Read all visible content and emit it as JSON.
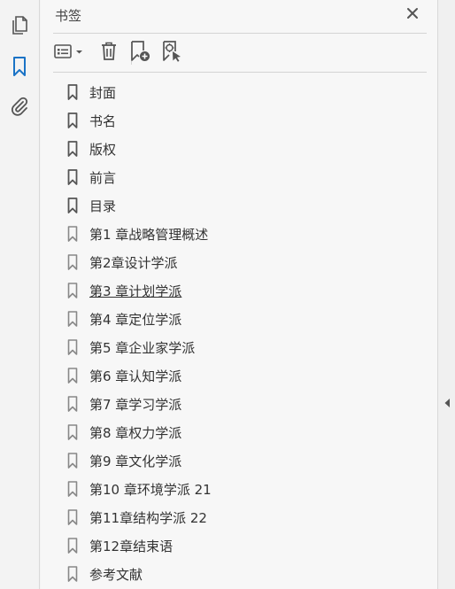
{
  "panel": {
    "title": "书签"
  },
  "icons": {
    "rail": [
      "pages-icon",
      "bookmark-icon",
      "attachment-icon"
    ],
    "toolbar": [
      "options-menu-icon",
      "delete-icon",
      "new-bookmark-icon",
      "new-bookmark-from-structure-icon"
    ],
    "close": "close-icon",
    "collapse": "collapse-arrow-icon"
  },
  "colors": {
    "accent": "#1a73c6",
    "icon": "#555555",
    "text": "#333333"
  },
  "bookmarks": [
    {
      "label": "封面"
    },
    {
      "label": "书名"
    },
    {
      "label": "版权"
    },
    {
      "label": "前言"
    },
    {
      "label": "目录"
    },
    {
      "label": "第1 章战略管理概述"
    },
    {
      "label": "第2章设计学派"
    },
    {
      "label": "第3 章计划学派"
    },
    {
      "label": "第4 章定位学派"
    },
    {
      "label": "第5 章企业家学派"
    },
    {
      "label": "第6 章认知学派"
    },
    {
      "label": "第7 章学习学派"
    },
    {
      "label": "第8 章权力学派"
    },
    {
      "label": "第9 章文化学派"
    },
    {
      "label": "第10 章环境学派  21"
    },
    {
      "label": "第11章结构学派 22"
    },
    {
      "label": "第12章结束语"
    },
    {
      "label": "参考文献"
    }
  ]
}
